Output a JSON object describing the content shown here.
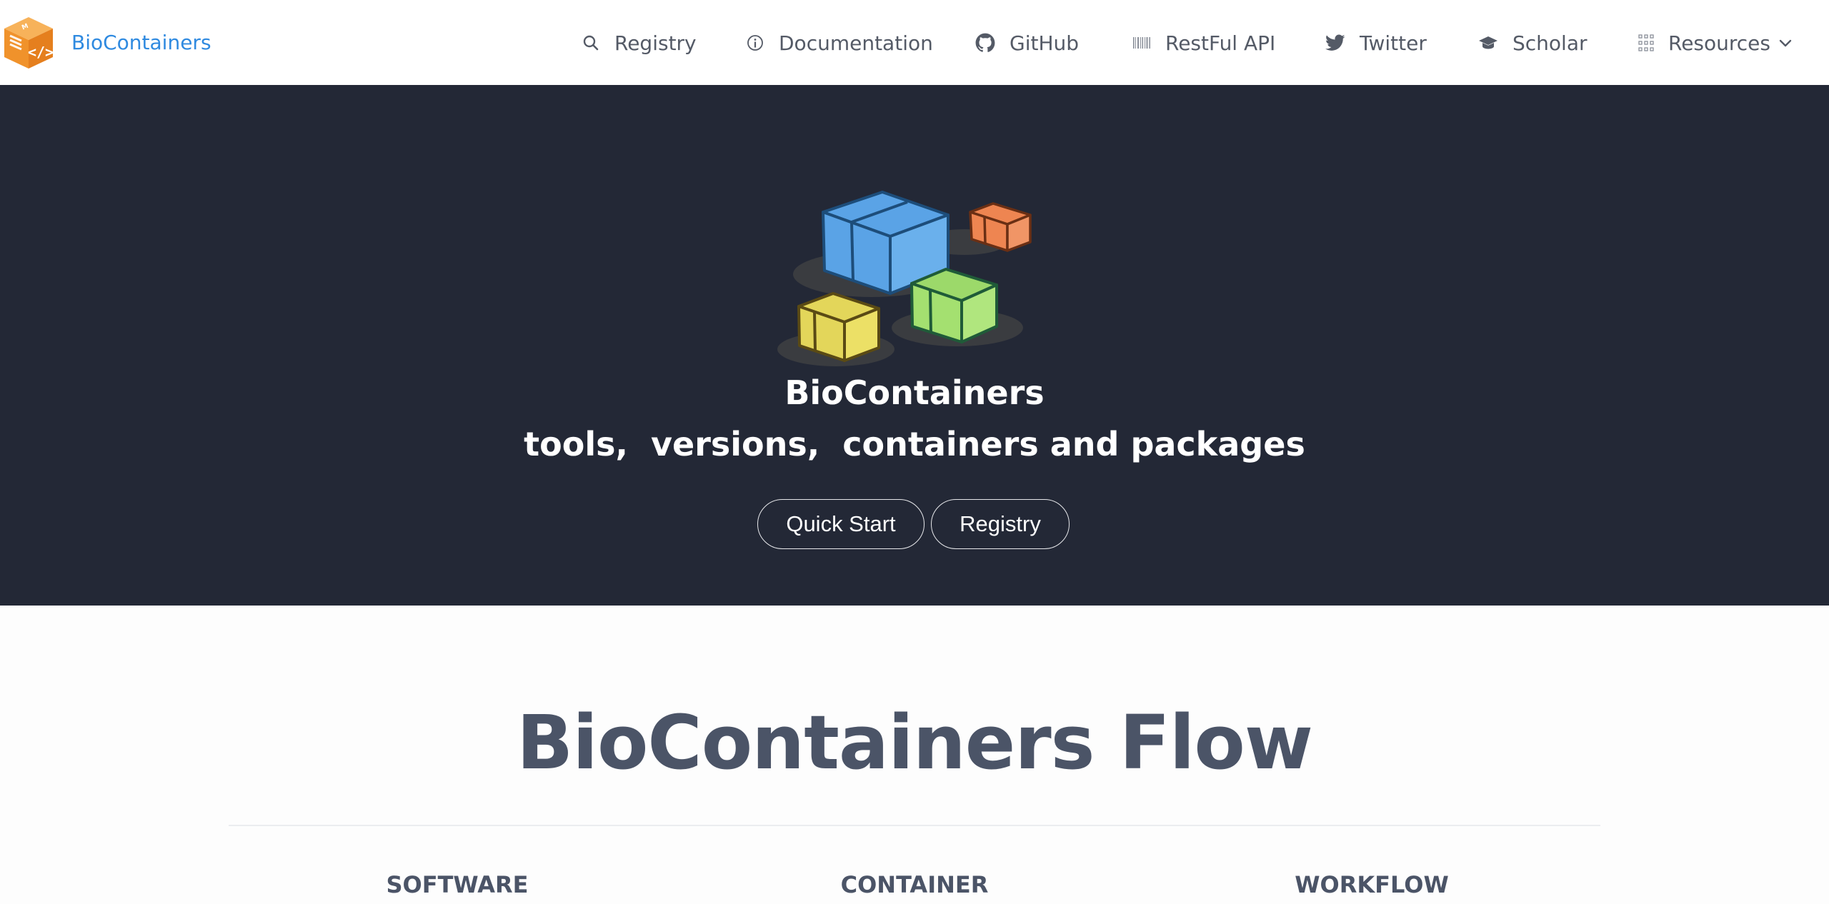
{
  "brand": {
    "name": "BioContainers",
    "color": "#2f8ae0"
  },
  "nav": {
    "items": [
      {
        "label": "Registry",
        "icon": "search-icon"
      },
      {
        "label": "Documentation",
        "icon": "info-icon"
      },
      {
        "label": "GitHub",
        "icon": "github-icon"
      },
      {
        "label": "RestFul API",
        "icon": "barcode-icon"
      },
      {
        "label": "Twitter",
        "icon": "twitter-icon"
      },
      {
        "label": "Scholar",
        "icon": "graduation-cap-icon"
      },
      {
        "label": "Resources",
        "icon": "grid-icon",
        "dropdown_icon": "chevron-down-icon"
      }
    ]
  },
  "hero": {
    "title": "BioContainers",
    "subtitle": "tools,  versions,  containers and packages",
    "buttons": {
      "quick_start": "Quick Start",
      "registry": "Registry"
    },
    "background": "#232836",
    "illustration": "containers-illustration"
  },
  "flow": {
    "title": "BioContainers Flow",
    "columns": [
      "SOFTWARE",
      "CONTAINER",
      "WORKFLOW"
    ]
  },
  "colors": {
    "text_dark": "#4b5467",
    "nav_text": "#545a66",
    "logo_orange": "#f0922b"
  }
}
